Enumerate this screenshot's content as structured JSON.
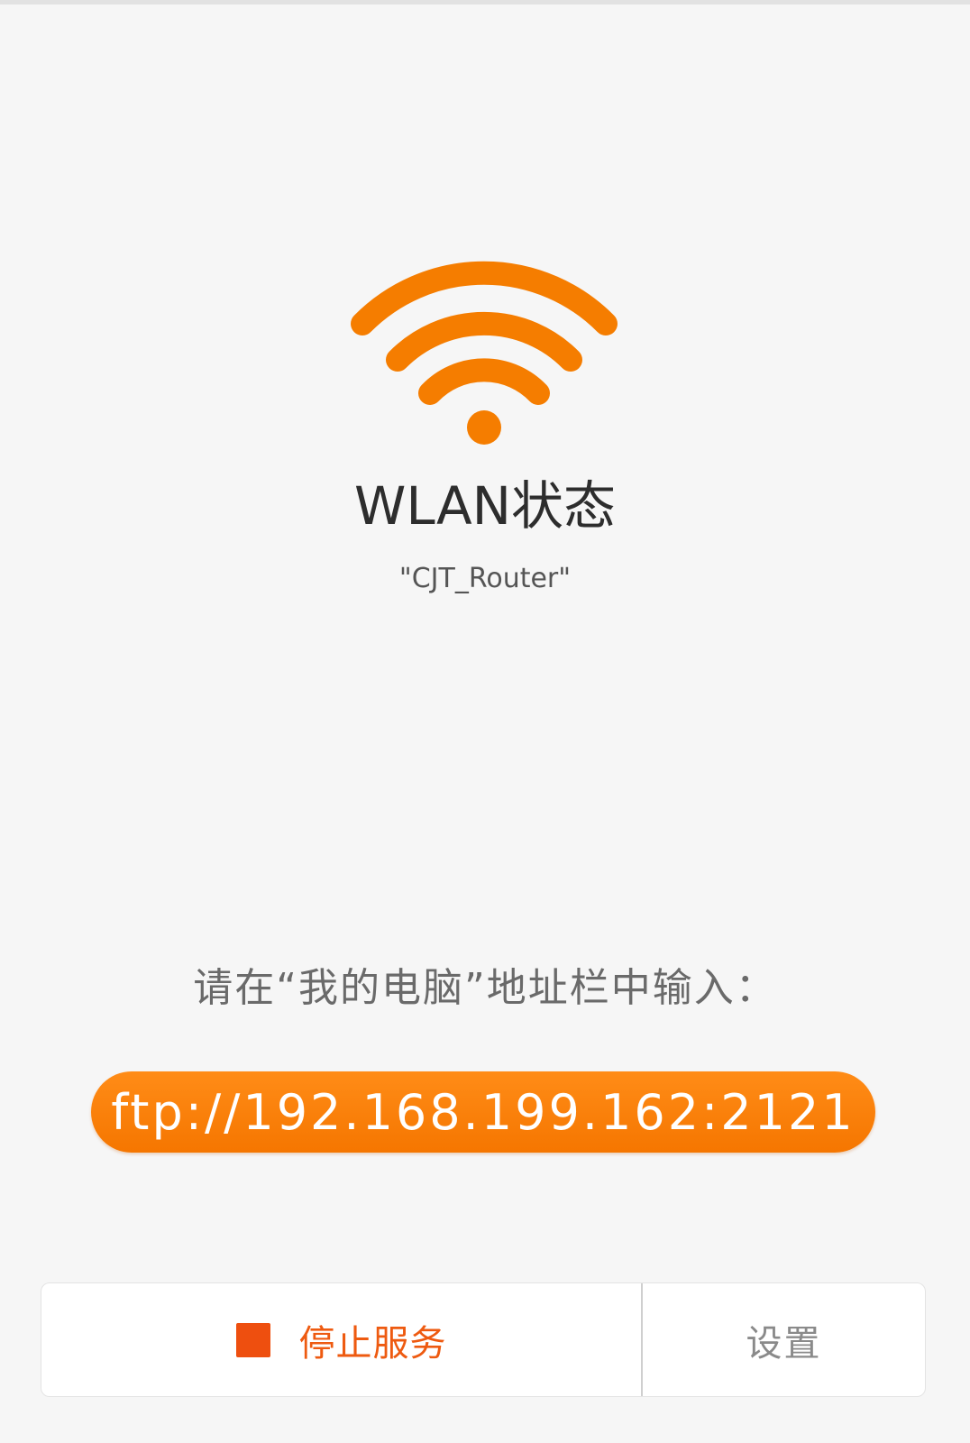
{
  "status": {
    "icon": "wifi-icon",
    "title": "WLAN状态",
    "ssid": "\"CJT_Router\""
  },
  "instruction": "请在“我的电脑”地址栏中输入：",
  "address": {
    "url": "ftp://192.168.199.162:2121"
  },
  "actions": {
    "stop_icon": "stop-square-icon",
    "stop_label": "停止服务",
    "settings_label": "设置"
  },
  "colors": {
    "accent": "#f57d00",
    "stop": "#ee4f0f",
    "background": "#f6f6f6"
  }
}
